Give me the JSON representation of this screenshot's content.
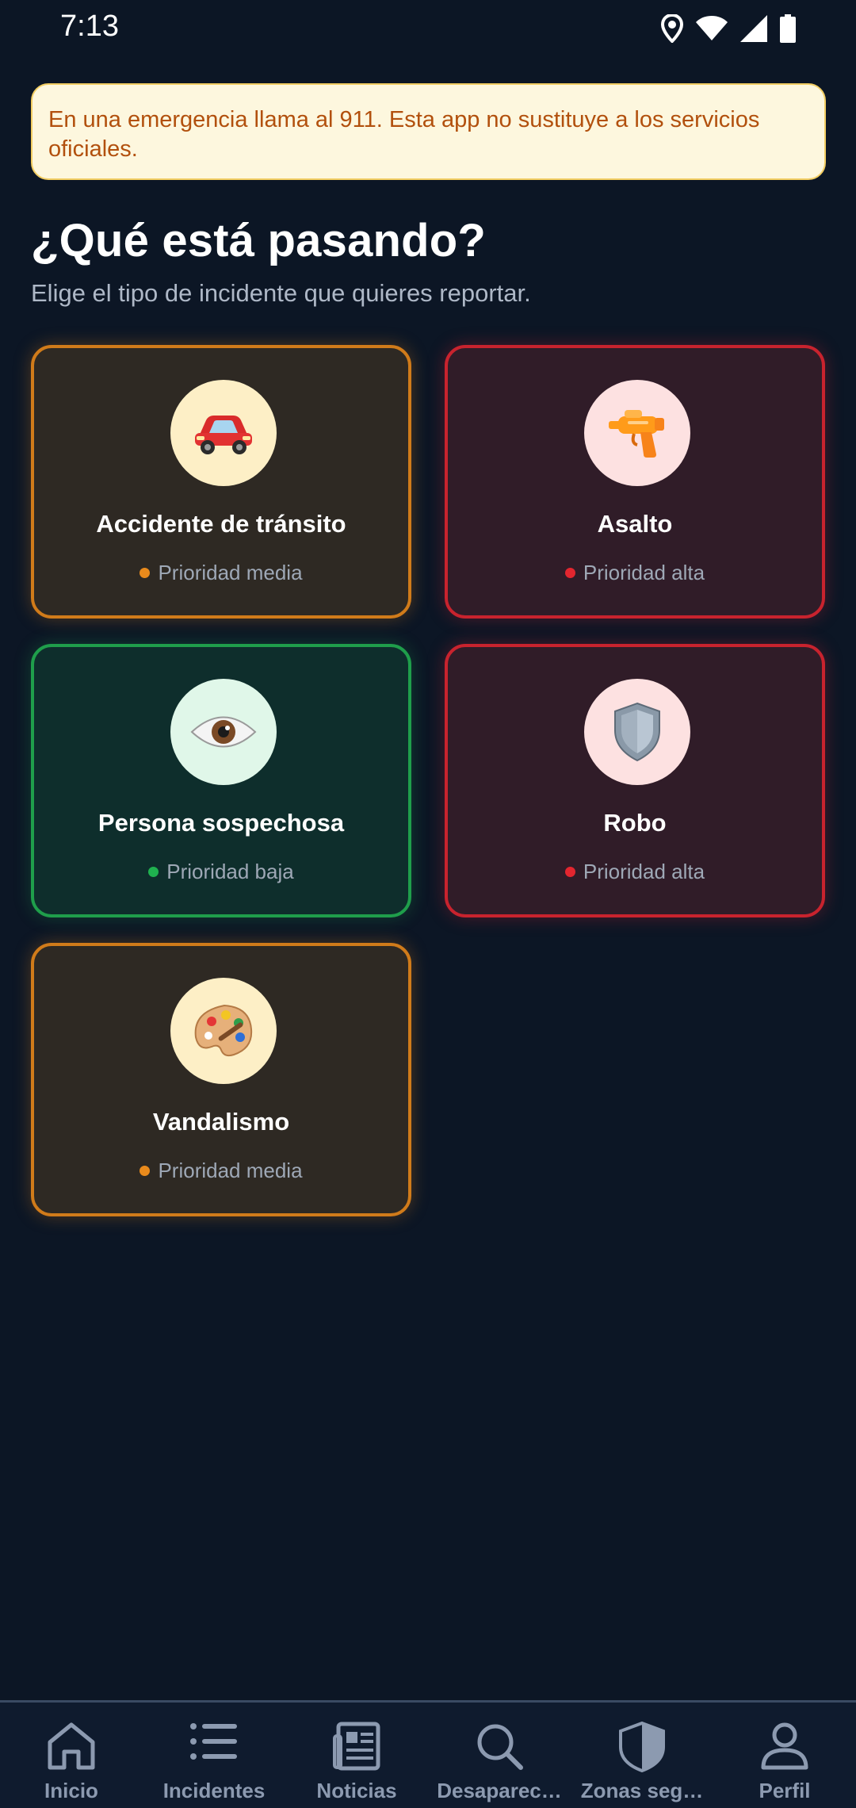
{
  "status_bar": {
    "time": "7:13",
    "icons": [
      "location-icon",
      "wifi-icon",
      "signal-icon",
      "battery-icon"
    ]
  },
  "banner": {
    "text": "En una emergencia llama al 911. Esta app no sustituye a los servicios oficiales."
  },
  "header": {
    "title": "¿Qué está pasando?",
    "subtitle": "Elige el tipo de incidente que quieres reportar."
  },
  "colors": {
    "background": "#0c1625",
    "priority_medium": "#e98a1c",
    "priority_high": "#e2262f",
    "priority_low": "#1fb14f",
    "banner_bg": "#fdf7de",
    "banner_text": "#b2500d"
  },
  "incident_types": [
    {
      "title": "Accidente de tránsito",
      "priority": "Prioridad media",
      "icon": "car-icon"
    },
    {
      "title": "Asalto",
      "priority": "Prioridad alta",
      "icon": "water-pistol-icon"
    },
    {
      "title": "Persona sospechosa",
      "priority": "Prioridad baja",
      "icon": "eye-icon"
    },
    {
      "title": "Robo",
      "priority": "Prioridad alta",
      "icon": "shield-icon"
    },
    {
      "title": "Vandalismo",
      "priority": "Prioridad media",
      "icon": "palette-icon"
    }
  ],
  "bottom_nav": [
    {
      "label": "Inicio",
      "icon": "home-icon"
    },
    {
      "label": "Incidentes",
      "icon": "list-icon"
    },
    {
      "label": "Noticias",
      "icon": "newspaper-icon"
    },
    {
      "label": "Desaparec…",
      "icon": "search-icon"
    },
    {
      "label": "Zonas seg…",
      "icon": "shield-icon"
    },
    {
      "label": "Perfil",
      "icon": "person-icon"
    }
  ]
}
